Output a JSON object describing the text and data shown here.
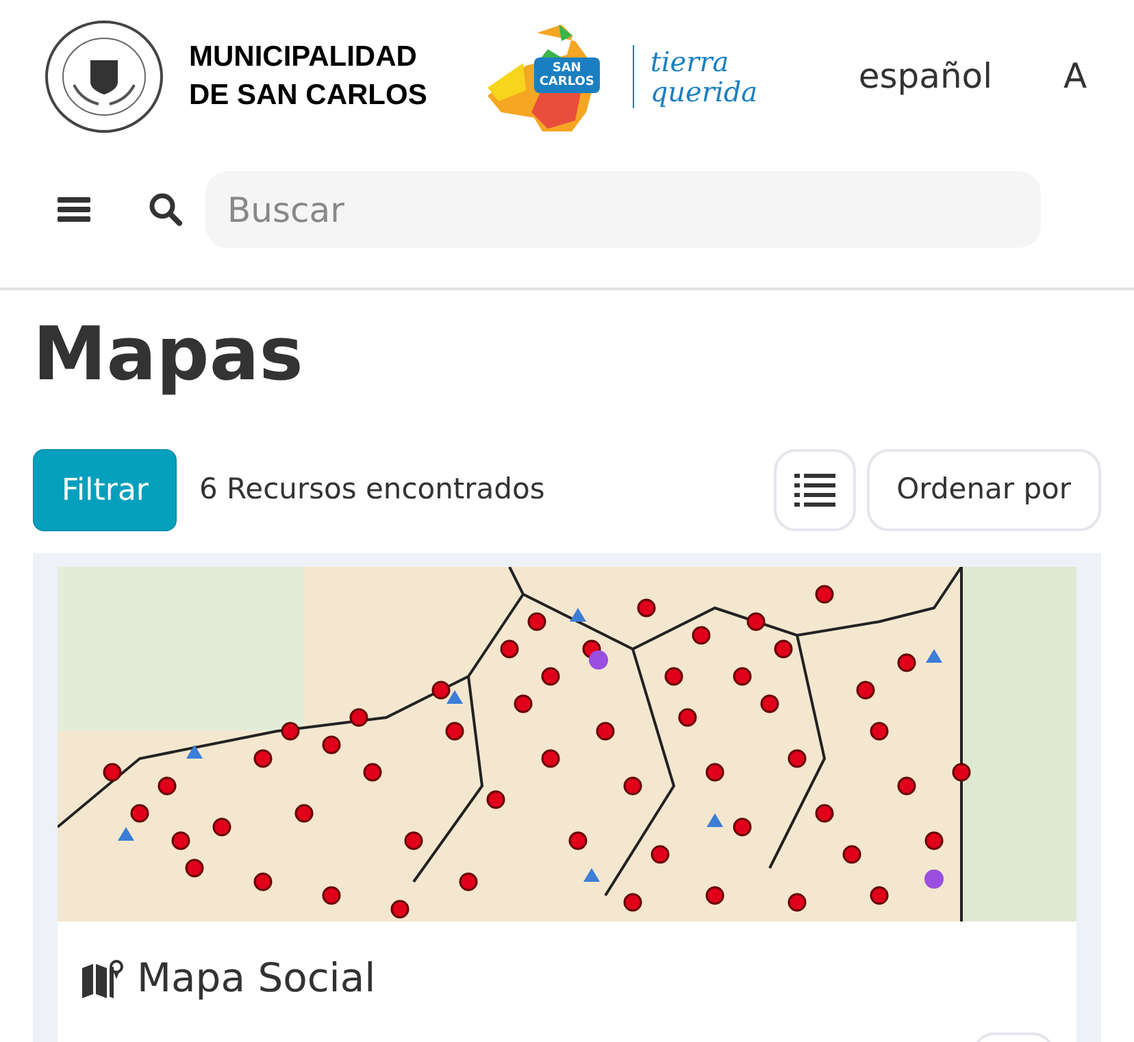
{
  "header": {
    "org_name_lines": [
      "MUNICIPALIDAD",
      "DE SAN CARLOS"
    ],
    "brand_badge": "SAN CARLOS",
    "brand_script": "tierra querida",
    "languages": [
      "español",
      "A"
    ]
  },
  "search": {
    "placeholder": "Buscar"
  },
  "page_title": "Mapas",
  "toolbar": {
    "filter_button": "Filtrar",
    "result_count": "6 Recursos encontrados",
    "sort_button": "Ordenar por"
  },
  "cards": [
    {
      "title": "Mapa Social"
    }
  ]
}
